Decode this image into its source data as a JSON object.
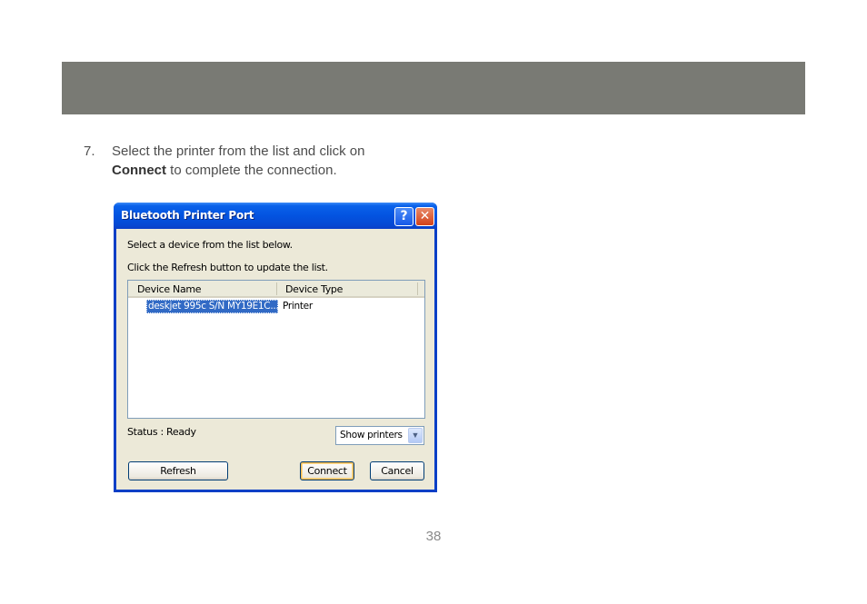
{
  "step": {
    "number": "7.",
    "text_line1": "Select the printer from the list and click on",
    "bold_word": "Connect",
    "text_line2_rest": " to complete the connection."
  },
  "dialog": {
    "title": "Bluetooth Printer Port",
    "help_glyph": "?",
    "close_glyph": "✕",
    "instruction1": "Select a device from the list below.",
    "instruction2": "Click the Refresh button to update the list.",
    "columns": [
      "Device Name",
      "Device Type"
    ],
    "rows": [
      {
        "name": "deskjet 995c S/N MY19E1C...",
        "type": "Printer"
      }
    ],
    "status": "Status : Ready",
    "filter": {
      "selected": "Show printers"
    },
    "buttons": {
      "refresh": "Refresh",
      "connect": "Connect",
      "cancel": "Cancel"
    }
  },
  "page_number": "38"
}
